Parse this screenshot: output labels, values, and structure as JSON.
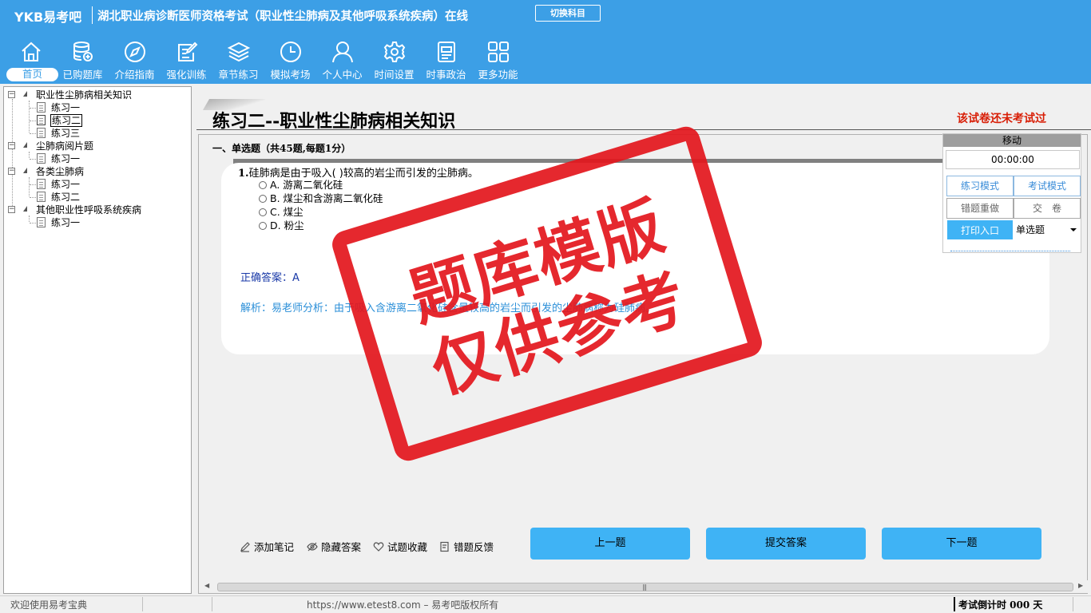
{
  "header": {
    "logo": "YKB易考吧",
    "title": "湖北职业病诊断医师资格考试（职业性尘肺病及其他呼吸系统疾病）在线",
    "switch_subject": "切换科目"
  },
  "nav": {
    "items": [
      {
        "label": "首页",
        "icon": "home-icon"
      },
      {
        "label": "已购题库",
        "icon": "database-icon"
      },
      {
        "label": "介绍指南",
        "icon": "compass-icon"
      },
      {
        "label": "强化训练",
        "icon": "edit-icon"
      },
      {
        "label": "章节练习",
        "icon": "layers-icon"
      },
      {
        "label": "模拟考场",
        "icon": "clock-icon"
      },
      {
        "label": "个人中心",
        "icon": "user-icon"
      },
      {
        "label": "时间设置",
        "icon": "gear-icon"
      },
      {
        "label": "时事政治",
        "icon": "news-icon"
      },
      {
        "label": "更多功能",
        "icon": "grid-icon"
      }
    ]
  },
  "tree": {
    "groups": [
      {
        "label": "职业性尘肺病相关知识",
        "children": [
          "练习一",
          "练习二",
          "练习三"
        ]
      },
      {
        "label": "尘肺病阅片题",
        "children": [
          "练习一"
        ]
      },
      {
        "label": "各类尘肺病",
        "children": [
          "练习一",
          "练习二"
        ]
      },
      {
        "label": "其他职业性呼吸系统疾病",
        "children": [
          "练习一"
        ]
      }
    ],
    "selected": "练习二"
  },
  "paper": {
    "title": "练习二--职业性尘肺病相关知识",
    "status": "该试卷还未考试过",
    "section": "一、单选题（共45题,每题1分）"
  },
  "question": {
    "number": "1.",
    "stem": "硅肺病是由于吸入( )较高的岩尘而引发的尘肺病。",
    "options": [
      "A. 游离二氧化硅",
      "B. 煤尘和含游离二氧化硅",
      "C. 煤尘",
      "D. 粉尘"
    ],
    "answer_label": "正确答案：",
    "answer": "A",
    "analysis": "解析：易老师分析：由于吸入含游离二氧化硅含量较高的岩尘而引发的尘肺病称为硅肺病。"
  },
  "stamp": {
    "line1": "题库模版",
    "line2": "仅供参考",
    "color": "#e3161d"
  },
  "panel": {
    "move": "移动",
    "timer": "00:00:00",
    "practice_mode": "练习模式",
    "exam_mode": "考试模式",
    "redo_wrong": "错题重做",
    "submit_paper": "交　卷",
    "print": "打印入口",
    "type_select": "单选题"
  },
  "tools": {
    "add_note": "添加笔记",
    "hide_answer": "隐藏答案",
    "favorite": "试题收藏",
    "feedback": "错题反馈"
  },
  "buttons": {
    "prev": "上一题",
    "submit": "提交答案",
    "next": "下一题"
  },
  "statusbar": {
    "welcome": "欢迎使用易考宝典",
    "copyright": "https://www.etest8.com – 易考吧版权所有",
    "countdown": "考试倒计时 000 天"
  },
  "colors": {
    "header": "#3c9fe6",
    "accent_button": "#3fb3f5",
    "status_red": "#d81e06"
  }
}
